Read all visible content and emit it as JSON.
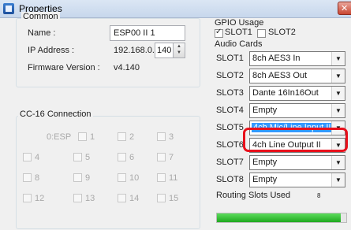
{
  "window": {
    "title": "Properties",
    "close": "✕"
  },
  "common": {
    "legend": "Common",
    "name_label": "Name :",
    "name_value": "ESP00 II 1",
    "ip_label": "IP Address :",
    "ip_prefix": "192.168.0.",
    "ip_last": "140",
    "fw_label": "Firmware Version :",
    "fw_value": "v4.140"
  },
  "cc16": {
    "legend": "CC-16 Connection",
    "esp_label": "0:ESP",
    "slots": [
      "1",
      "2",
      "3",
      "4",
      "5",
      "6",
      "7",
      "8",
      "9",
      "10",
      "11",
      "12",
      "13",
      "14",
      "15"
    ]
  },
  "gpio": {
    "legend": "GPIO Usage",
    "slot1_label": "SLOT1",
    "slot1_checked": true,
    "slot2_label": "SLOT2",
    "slot2_checked": false
  },
  "audio_cards": {
    "legend": "Audio Cards",
    "slots": [
      {
        "label": "SLOT1",
        "value": "8ch AES3 In"
      },
      {
        "label": "SLOT2",
        "value": "8ch AES3 Out"
      },
      {
        "label": "SLOT3",
        "value": "Dante 16In16Out"
      },
      {
        "label": "SLOT4",
        "value": "Empty"
      },
      {
        "label": "SLOT5",
        "value": "4ch Mic/Line Input II"
      },
      {
        "label": "SLOT6",
        "value": "4ch Line Output II"
      },
      {
        "label": "SLOT7",
        "value": "Empty"
      },
      {
        "label": "SLOT8",
        "value": "Empty"
      }
    ],
    "selected_index": 4
  },
  "routing": {
    "label": "Routing Slots Used",
    "value": "8",
    "fraction": 0.96
  },
  "colors": {
    "highlight": "#e8101b",
    "selection": "#3399ff",
    "progress": "#2bbf2b"
  }
}
